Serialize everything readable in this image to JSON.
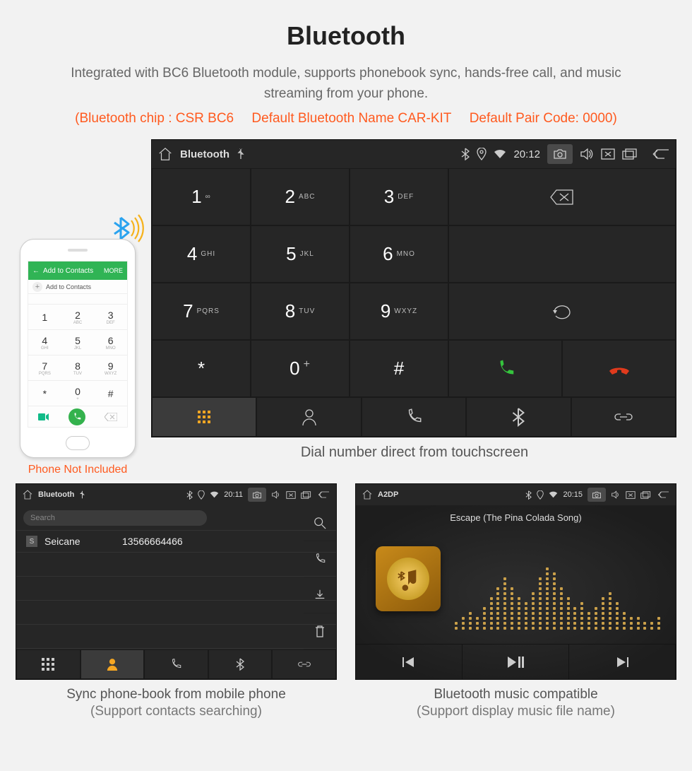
{
  "header": {
    "title": "Bluetooth",
    "subtitle": "Integrated with BC6 Bluetooth module, supports phonebook sync, hands-free call, and music streaming from your phone.",
    "spec_chip": "(Bluetooth chip : CSR BC6",
    "spec_name": "Default Bluetooth Name CAR-KIT",
    "spec_pair": "Default Pair Code: 0000)"
  },
  "phone_mock": {
    "header_label": "Add to Contacts",
    "header_more": "MORE",
    "keys": [
      {
        "n": "1",
        "s": ""
      },
      {
        "n": "2",
        "s": "ABC"
      },
      {
        "n": "3",
        "s": "DEF"
      },
      {
        "n": "4",
        "s": "GHI"
      },
      {
        "n": "5",
        "s": "JKL"
      },
      {
        "n": "6",
        "s": "MNO"
      },
      {
        "n": "7",
        "s": "PQRS"
      },
      {
        "n": "8",
        "s": "TUV"
      },
      {
        "n": "9",
        "s": "WXYZ"
      },
      {
        "n": "*",
        "s": ""
      },
      {
        "n": "0",
        "s": "+"
      },
      {
        "n": "#",
        "s": ""
      }
    ],
    "caption": "Phone Not Included"
  },
  "hu_dialer": {
    "status": {
      "title": "Bluetooth",
      "time": "20:12"
    },
    "keys": [
      {
        "n": "1",
        "s": "∞"
      },
      {
        "n": "2",
        "s": "ABC"
      },
      {
        "n": "3",
        "s": "DEF"
      },
      {
        "n": "4",
        "s": "GHI"
      },
      {
        "n": "5",
        "s": "JKL"
      },
      {
        "n": "6",
        "s": "MNO"
      },
      {
        "n": "7",
        "s": "PQRS"
      },
      {
        "n": "8",
        "s": "TUV"
      },
      {
        "n": "9",
        "s": "WXYZ"
      },
      {
        "n": "*",
        "s": ""
      },
      {
        "n": "0",
        "s": "+"
      },
      {
        "n": "#",
        "s": ""
      }
    ],
    "caption": "Dial number direct from touchscreen"
  },
  "hu_phonebook": {
    "status": {
      "title": "Bluetooth",
      "time": "20:11"
    },
    "search_placeholder": "Search",
    "contact": {
      "initial": "S",
      "name": "Seicane",
      "number": "13566664466"
    },
    "caption_line1": "Sync phone-book from mobile phone",
    "caption_line2": "(Support contacts searching)"
  },
  "hu_music": {
    "status": {
      "title": "A2DP",
      "time": "20:15"
    },
    "track": "Escape (The Pina Colada Song)",
    "caption_line1": "Bluetooth music compatible",
    "caption_line2": "(Support display music file name)"
  },
  "vis_heights": [
    2,
    3,
    4,
    3,
    5,
    7,
    9,
    11,
    9,
    7,
    6,
    8,
    11,
    13,
    12,
    9,
    7,
    5,
    6,
    4,
    5,
    7,
    8,
    6,
    4,
    3,
    3,
    2,
    2,
    3
  ]
}
